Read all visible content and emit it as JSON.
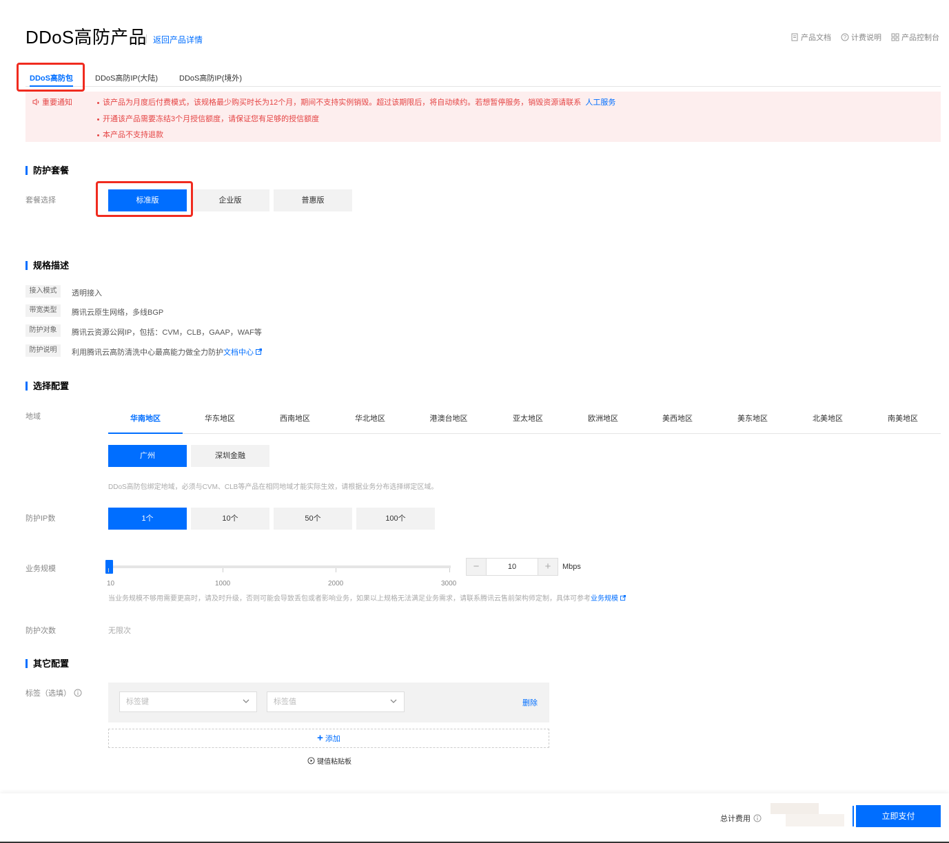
{
  "header": {
    "title": "DDoS高防产品",
    "back_link": "返回产品详情",
    "top_links": [
      "产品文档",
      "计费说明",
      "产品控制台"
    ]
  },
  "tabs": [
    "DDoS高防包",
    "DDoS高防IP(大陆)",
    "DDoS高防IP(境外)"
  ],
  "notice": {
    "label": "重要通知",
    "lines": [
      "该产品为月度后付费模式，该规格最少购买时长为12个月，期间不支持实例销毁。超过该期限后，将自动续约。若想暂停服务，销毁资源请联系",
      "开通该产品需要冻结3个月授信额度，请保证您有足够的授信额度",
      "本产品不支持退款"
    ],
    "link": "人工服务"
  },
  "package": {
    "section": "防护套餐",
    "label": "套餐选择",
    "options": [
      "标准版",
      "企业版",
      "普惠版"
    ]
  },
  "spec": {
    "section": "规格描述",
    "rows": [
      {
        "key": "接入模式",
        "value": "透明接入"
      },
      {
        "key": "带宽类型",
        "value": "腾讯云原生网络，多线BGP"
      },
      {
        "key": "防护对象",
        "value": "腾讯云资源公网IP，包括：CVM，CLB，GAAP，WAF等"
      },
      {
        "key": "防护说明",
        "value": "利用腾讯云高防清洗中心最高能力做全力防护"
      }
    ],
    "doc_link": "文档中心"
  },
  "config": {
    "section": "选择配置",
    "region_label": "地域",
    "regions": [
      "华南地区",
      "华东地区",
      "西南地区",
      "华北地区",
      "港澳台地区",
      "亚太地区",
      "欧洲地区",
      "美西地区",
      "美东地区",
      "北美地区",
      "南美地区"
    ],
    "cities": [
      "广州",
      "深圳金融"
    ],
    "region_hint": "DDoS高防包绑定地域，必须与CVM、CLB等产品在相同地域才能实际生效，请根据业务分布选择绑定区域。",
    "ip_label": "防护IP数",
    "ip_options": [
      "1个",
      "10个",
      "50个",
      "100个"
    ],
    "scale_label": "业务规模",
    "scale_ticks": [
      "10",
      "1000",
      "2000",
      "3000"
    ],
    "scale_value": "10",
    "scale_unit": "Mbps",
    "scale_hint": "当业务规模不够用需要更高时，请及时升级，否则可能会导致丢包或者影响业务，如果以上规格无法满足业务需求，请联系腾讯云售前架构师定制，具体可参考",
    "scale_link": "业务规模",
    "times_label": "防护次数",
    "times_value": "无限次"
  },
  "other": {
    "section": "其它配置",
    "tag_label": "标签（选填）",
    "tag_key_placeholder": "标签键",
    "tag_value_placeholder": "标签值",
    "delete": "删除",
    "add": "添加",
    "paste": "键值粘贴板"
  },
  "footer": {
    "total_label": "总计费用",
    "pay": "立即支付"
  },
  "colors": {
    "accent": "#006eff",
    "alert": "#e54545",
    "highlight_box": "#f02b1f"
  }
}
